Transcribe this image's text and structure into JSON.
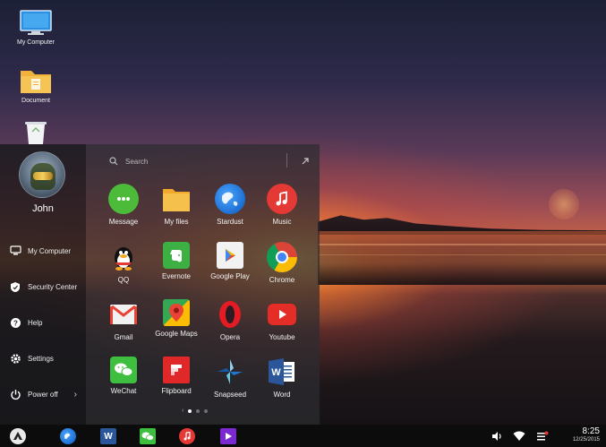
{
  "desktop": {
    "icons": [
      {
        "label": "My Computer",
        "icon": "monitor-icon"
      },
      {
        "label": "Document",
        "icon": "folder-icon"
      },
      {
        "label": "",
        "icon": "recycle-bin-icon"
      }
    ]
  },
  "start_menu": {
    "user": {
      "name": "John",
      "avatar": "avatar"
    },
    "side_items": [
      {
        "label": "My Computer",
        "icon": "monitor-icon"
      },
      {
        "label": "Security Center",
        "icon": "shield-icon"
      },
      {
        "label": "Help",
        "icon": "help-icon"
      },
      {
        "label": "Settings",
        "icon": "gear-icon"
      },
      {
        "label": "Power off",
        "icon": "power-icon",
        "chevron": "›"
      }
    ],
    "search": {
      "placeholder": "Search"
    },
    "apps": [
      {
        "label": "Message",
        "icon": "message-icon",
        "color": "#4cbb3a"
      },
      {
        "label": "My files",
        "icon": "folder-icon",
        "color": "#f3b33d"
      },
      {
        "label": "Stardust",
        "icon": "globe-icon",
        "color": "#1b6fd1"
      },
      {
        "label": "Music",
        "icon": "music-icon",
        "color": "#e53935"
      },
      {
        "label": "QQ",
        "icon": "penguin-icon",
        "color": "#111111"
      },
      {
        "label": "Evernote",
        "icon": "elephant-icon",
        "color": "#3cb043"
      },
      {
        "label": "Google Play",
        "icon": "play-store-icon",
        "color": "#ffffff"
      },
      {
        "label": "Chrome",
        "icon": "chrome-icon",
        "color": "#db4437"
      },
      {
        "label": "Gmail",
        "icon": "gmail-icon",
        "color": "#ea4335"
      },
      {
        "label": "Google Maps",
        "icon": "maps-icon",
        "color": "#34a853"
      },
      {
        "label": "Opera",
        "icon": "opera-icon",
        "color": "#e21b24"
      },
      {
        "label": "Youtube",
        "icon": "youtube-icon",
        "color": "#e52d27"
      },
      {
        "label": "WeChat",
        "icon": "wechat-icon",
        "color": "#3fbf3f"
      },
      {
        "label": "Flipboard",
        "icon": "flipboard-icon",
        "color": "#e12828"
      },
      {
        "label": "Snapseed",
        "icon": "snapseed-icon",
        "color": "#2a7ad8"
      },
      {
        "label": "Word",
        "icon": "word-icon",
        "color": "#2b579a"
      }
    ],
    "page_indicator": {
      "pages": 3,
      "active": 1
    }
  },
  "taskbar": {
    "apps": [
      {
        "icon": "start-logo-icon"
      },
      {
        "icon": "globe-icon",
        "color": "#1b6fd1"
      },
      {
        "icon": "word-icon",
        "color": "#2b579a"
      },
      {
        "icon": "wechat-icon",
        "color": "#3fbf3f"
      },
      {
        "icon": "music-icon",
        "color": "#e53935"
      },
      {
        "icon": "video-icon",
        "color": "#7b2ad1"
      }
    ],
    "tray": {
      "time": "8:25",
      "date": "12/25/2015"
    }
  },
  "colors": {
    "accent": "#ffffff",
    "panel_dark": "#19191c",
    "panel_mid": "#2d2d30"
  }
}
